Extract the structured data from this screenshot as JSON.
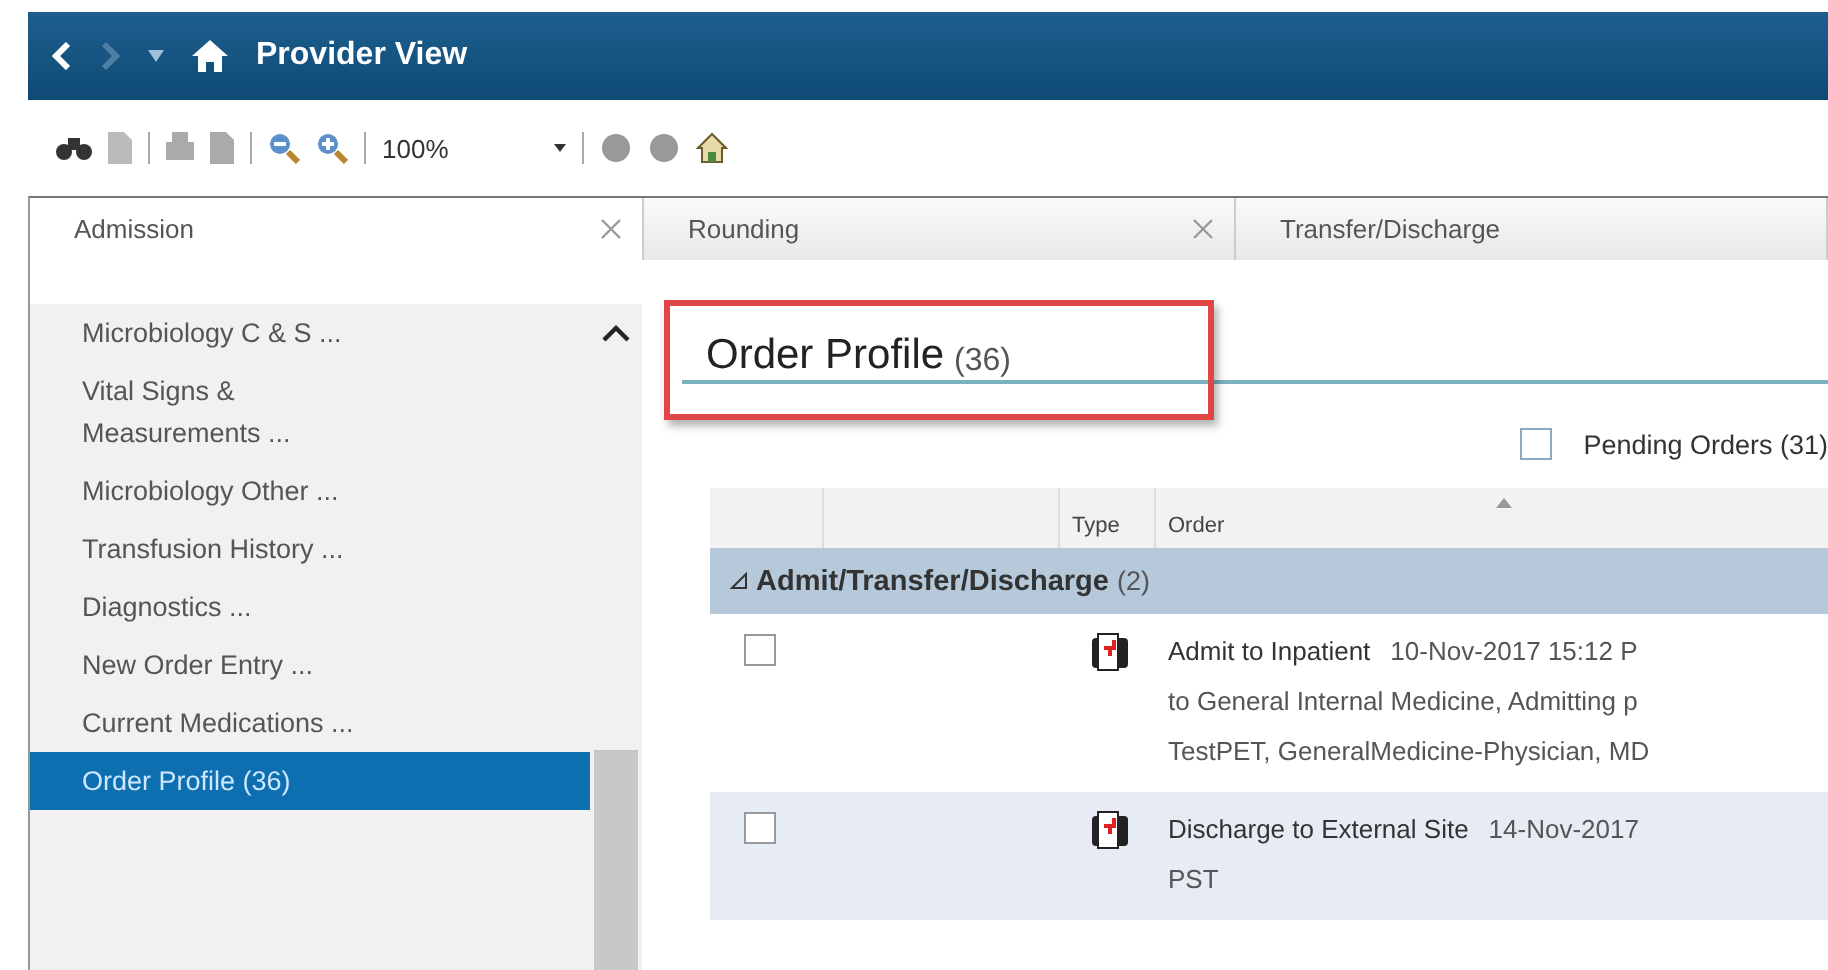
{
  "header": {
    "title": "Provider View"
  },
  "toolbar": {
    "zoom": "100%"
  },
  "tabs": [
    {
      "label": "Admission",
      "selected": true
    },
    {
      "label": "Rounding",
      "selected": false
    },
    {
      "label": "Transfer/Discharge",
      "selected": false
    }
  ],
  "sidebar": {
    "items": [
      {
        "label": "Microbiology C & S ...",
        "selected": false
      },
      {
        "label": "Vital Signs & Measurements ...",
        "selected": false
      },
      {
        "label": "Microbiology Other ...",
        "selected": false
      },
      {
        "label": "Transfusion History ...",
        "selected": false
      },
      {
        "label": "Diagnostics ...",
        "selected": false
      },
      {
        "label": "New Order Entry ...",
        "selected": false
      },
      {
        "label": "Current Medications ...",
        "selected": false
      },
      {
        "label": "Order Profile (36)",
        "selected": true
      }
    ]
  },
  "section": {
    "title": "Order Profile",
    "count": "(36)",
    "highlighted": true
  },
  "filter": {
    "label": "Pending Orders (31)",
    "checked": false
  },
  "table": {
    "columns": [
      "Type",
      "Order"
    ],
    "groups": [
      {
        "label": "Admit/Transfer/Discharge",
        "count": "(2)",
        "expanded": true,
        "rows": [
          {
            "checked": false,
            "order": "Admit to Inpatient",
            "details": [
              "10-Nov-2017 15:12 P",
              "to General Internal Medicine, Admitting p",
              "TestPET, GeneralMedicine-Physician, MD"
            ]
          },
          {
            "checked": false,
            "order": "Discharge to External Site",
            "details": [
              "14-Nov-2017",
              "PST"
            ]
          }
        ]
      }
    ]
  }
}
